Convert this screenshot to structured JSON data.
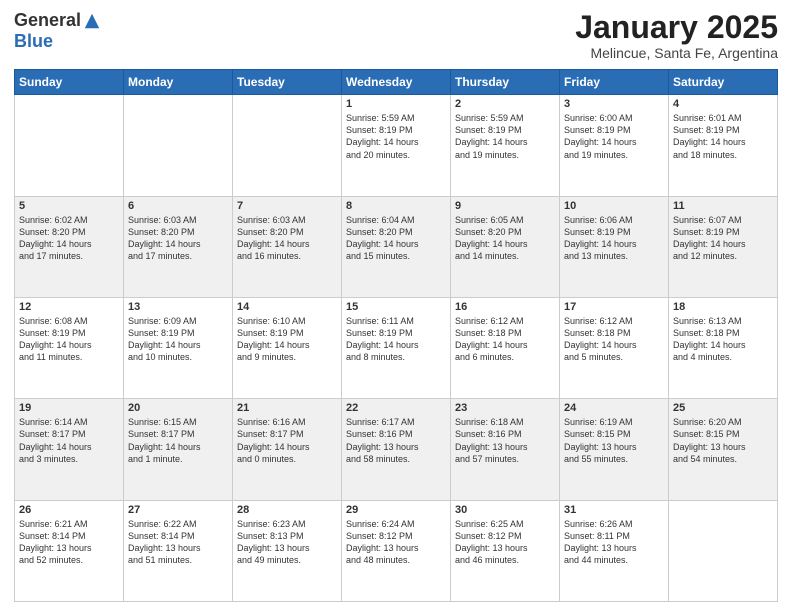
{
  "logo": {
    "general": "General",
    "blue": "Blue"
  },
  "title": "January 2025",
  "subtitle": "Melincue, Santa Fe, Argentina",
  "days_of_week": [
    "Sunday",
    "Monday",
    "Tuesday",
    "Wednesday",
    "Thursday",
    "Friday",
    "Saturday"
  ],
  "weeks": [
    {
      "shade": false,
      "days": [
        {
          "num": "",
          "info": ""
        },
        {
          "num": "",
          "info": ""
        },
        {
          "num": "",
          "info": ""
        },
        {
          "num": "1",
          "info": "Sunrise: 5:59 AM\nSunset: 8:19 PM\nDaylight: 14 hours\nand 20 minutes."
        },
        {
          "num": "2",
          "info": "Sunrise: 5:59 AM\nSunset: 8:19 PM\nDaylight: 14 hours\nand 19 minutes."
        },
        {
          "num": "3",
          "info": "Sunrise: 6:00 AM\nSunset: 8:19 PM\nDaylight: 14 hours\nand 19 minutes."
        },
        {
          "num": "4",
          "info": "Sunrise: 6:01 AM\nSunset: 8:19 PM\nDaylight: 14 hours\nand 18 minutes."
        }
      ]
    },
    {
      "shade": true,
      "days": [
        {
          "num": "5",
          "info": "Sunrise: 6:02 AM\nSunset: 8:20 PM\nDaylight: 14 hours\nand 17 minutes."
        },
        {
          "num": "6",
          "info": "Sunrise: 6:03 AM\nSunset: 8:20 PM\nDaylight: 14 hours\nand 17 minutes."
        },
        {
          "num": "7",
          "info": "Sunrise: 6:03 AM\nSunset: 8:20 PM\nDaylight: 14 hours\nand 16 minutes."
        },
        {
          "num": "8",
          "info": "Sunrise: 6:04 AM\nSunset: 8:20 PM\nDaylight: 14 hours\nand 15 minutes."
        },
        {
          "num": "9",
          "info": "Sunrise: 6:05 AM\nSunset: 8:20 PM\nDaylight: 14 hours\nand 14 minutes."
        },
        {
          "num": "10",
          "info": "Sunrise: 6:06 AM\nSunset: 8:19 PM\nDaylight: 14 hours\nand 13 minutes."
        },
        {
          "num": "11",
          "info": "Sunrise: 6:07 AM\nSunset: 8:19 PM\nDaylight: 14 hours\nand 12 minutes."
        }
      ]
    },
    {
      "shade": false,
      "days": [
        {
          "num": "12",
          "info": "Sunrise: 6:08 AM\nSunset: 8:19 PM\nDaylight: 14 hours\nand 11 minutes."
        },
        {
          "num": "13",
          "info": "Sunrise: 6:09 AM\nSunset: 8:19 PM\nDaylight: 14 hours\nand 10 minutes."
        },
        {
          "num": "14",
          "info": "Sunrise: 6:10 AM\nSunset: 8:19 PM\nDaylight: 14 hours\nand 9 minutes."
        },
        {
          "num": "15",
          "info": "Sunrise: 6:11 AM\nSunset: 8:19 PM\nDaylight: 14 hours\nand 8 minutes."
        },
        {
          "num": "16",
          "info": "Sunrise: 6:12 AM\nSunset: 8:18 PM\nDaylight: 14 hours\nand 6 minutes."
        },
        {
          "num": "17",
          "info": "Sunrise: 6:12 AM\nSunset: 8:18 PM\nDaylight: 14 hours\nand 5 minutes."
        },
        {
          "num": "18",
          "info": "Sunrise: 6:13 AM\nSunset: 8:18 PM\nDaylight: 14 hours\nand 4 minutes."
        }
      ]
    },
    {
      "shade": true,
      "days": [
        {
          "num": "19",
          "info": "Sunrise: 6:14 AM\nSunset: 8:17 PM\nDaylight: 14 hours\nand 3 minutes."
        },
        {
          "num": "20",
          "info": "Sunrise: 6:15 AM\nSunset: 8:17 PM\nDaylight: 14 hours\nand 1 minute."
        },
        {
          "num": "21",
          "info": "Sunrise: 6:16 AM\nSunset: 8:17 PM\nDaylight: 14 hours\nand 0 minutes."
        },
        {
          "num": "22",
          "info": "Sunrise: 6:17 AM\nSunset: 8:16 PM\nDaylight: 13 hours\nand 58 minutes."
        },
        {
          "num": "23",
          "info": "Sunrise: 6:18 AM\nSunset: 8:16 PM\nDaylight: 13 hours\nand 57 minutes."
        },
        {
          "num": "24",
          "info": "Sunrise: 6:19 AM\nSunset: 8:15 PM\nDaylight: 13 hours\nand 55 minutes."
        },
        {
          "num": "25",
          "info": "Sunrise: 6:20 AM\nSunset: 8:15 PM\nDaylight: 13 hours\nand 54 minutes."
        }
      ]
    },
    {
      "shade": false,
      "days": [
        {
          "num": "26",
          "info": "Sunrise: 6:21 AM\nSunset: 8:14 PM\nDaylight: 13 hours\nand 52 minutes."
        },
        {
          "num": "27",
          "info": "Sunrise: 6:22 AM\nSunset: 8:14 PM\nDaylight: 13 hours\nand 51 minutes."
        },
        {
          "num": "28",
          "info": "Sunrise: 6:23 AM\nSunset: 8:13 PM\nDaylight: 13 hours\nand 49 minutes."
        },
        {
          "num": "29",
          "info": "Sunrise: 6:24 AM\nSunset: 8:12 PM\nDaylight: 13 hours\nand 48 minutes."
        },
        {
          "num": "30",
          "info": "Sunrise: 6:25 AM\nSunset: 8:12 PM\nDaylight: 13 hours\nand 46 minutes."
        },
        {
          "num": "31",
          "info": "Sunrise: 6:26 AM\nSunset: 8:11 PM\nDaylight: 13 hours\nand 44 minutes."
        },
        {
          "num": "",
          "info": ""
        }
      ]
    }
  ]
}
